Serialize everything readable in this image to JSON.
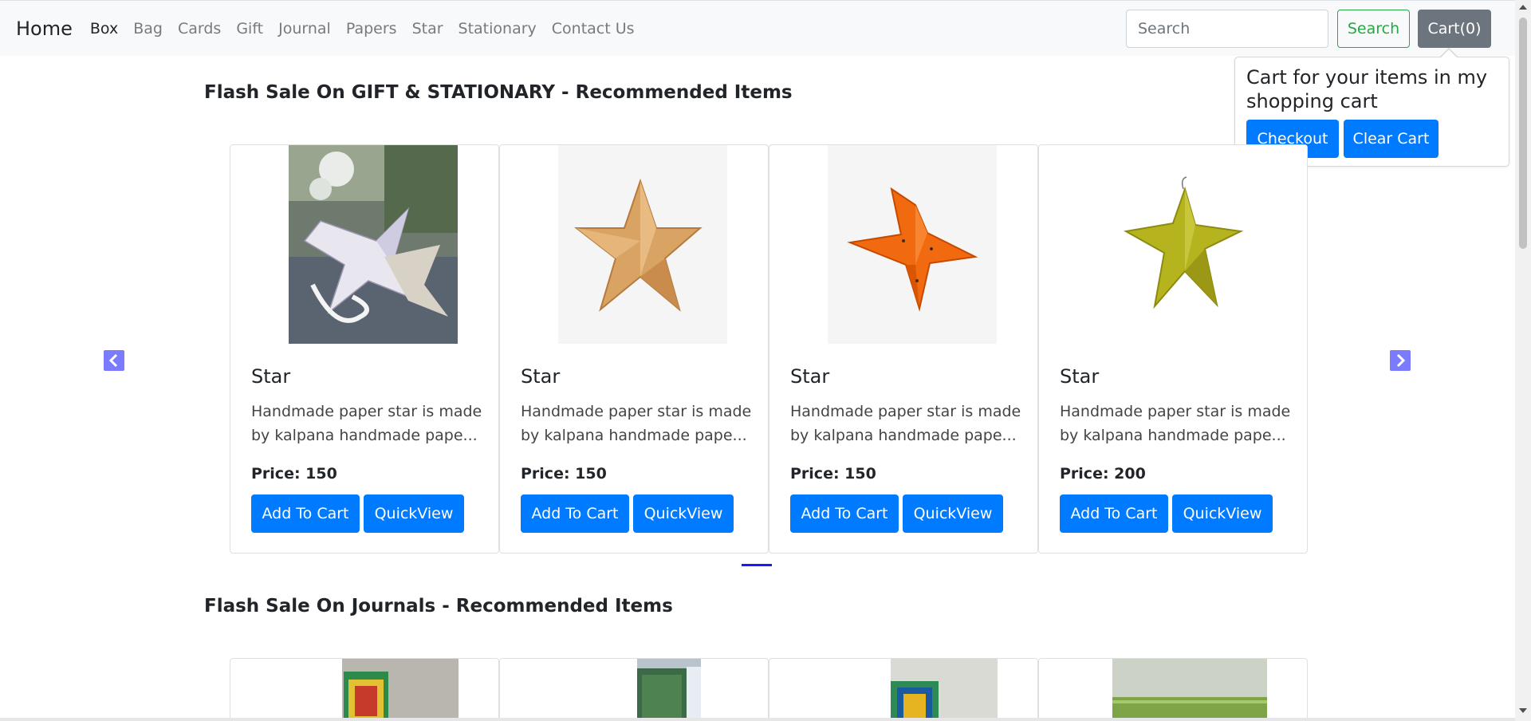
{
  "navbar": {
    "brand": "Home",
    "links": [
      {
        "label": "Box",
        "active": true
      },
      {
        "label": "Bag",
        "active": false
      },
      {
        "label": "Cards",
        "active": false
      },
      {
        "label": "Gift",
        "active": false
      },
      {
        "label": "Journal",
        "active": false
      },
      {
        "label": "Papers",
        "active": false
      },
      {
        "label": "Star",
        "active": false
      },
      {
        "label": "Stationary",
        "active": false
      },
      {
        "label": "Contact Us",
        "active": false
      }
    ],
    "search_placeholder": "Search",
    "search_button": "Search",
    "cart_button": "Cart(0)"
  },
  "cart_popover": {
    "title": "Cart for your items in my shopping cart",
    "checkout_label": "Checkout",
    "clear_label": "Clear Cart"
  },
  "sections": [
    {
      "title": "Flash Sale On GIFT & STATIONARY - Recommended Items",
      "items": [
        {
          "name": "Star",
          "description": "Handmade paper star is made by kalpana handmade pape...",
          "price": "Price: 150",
          "add_label": "Add To Cart",
          "quick_label": "QuickView",
          "image": "star-photo-white"
        },
        {
          "name": "Star",
          "description": "Handmade paper star is made by kalpana handmade pape...",
          "price": "Price: 150",
          "add_label": "Add To Cart",
          "quick_label": "QuickView",
          "image": "star-gold"
        },
        {
          "name": "Star",
          "description": "Handmade paper star is made by kalpana handmade pape...",
          "price": "Price: 150",
          "add_label": "Add To Cart",
          "quick_label": "QuickView",
          "image": "star-orange"
        },
        {
          "name": "Star",
          "description": "Handmade paper star is made by kalpana handmade pape...",
          "price": "Price: 200",
          "add_label": "Add To Cart",
          "quick_label": "QuickView",
          "image": "star-green"
        }
      ]
    },
    {
      "title": "Flash Sale On Journals - Recommended Items",
      "items": []
    }
  ],
  "colors": {
    "primary": "#007bff",
    "success": "#28a745",
    "secondary": "#6c757d",
    "navbar_bg": "#f8f9fa",
    "carousel_arrow": "#7b7bff",
    "indicator": "#1a1aff"
  },
  "icons": {
    "prev": "chevron-left-icon",
    "next": "chevron-right-icon"
  }
}
